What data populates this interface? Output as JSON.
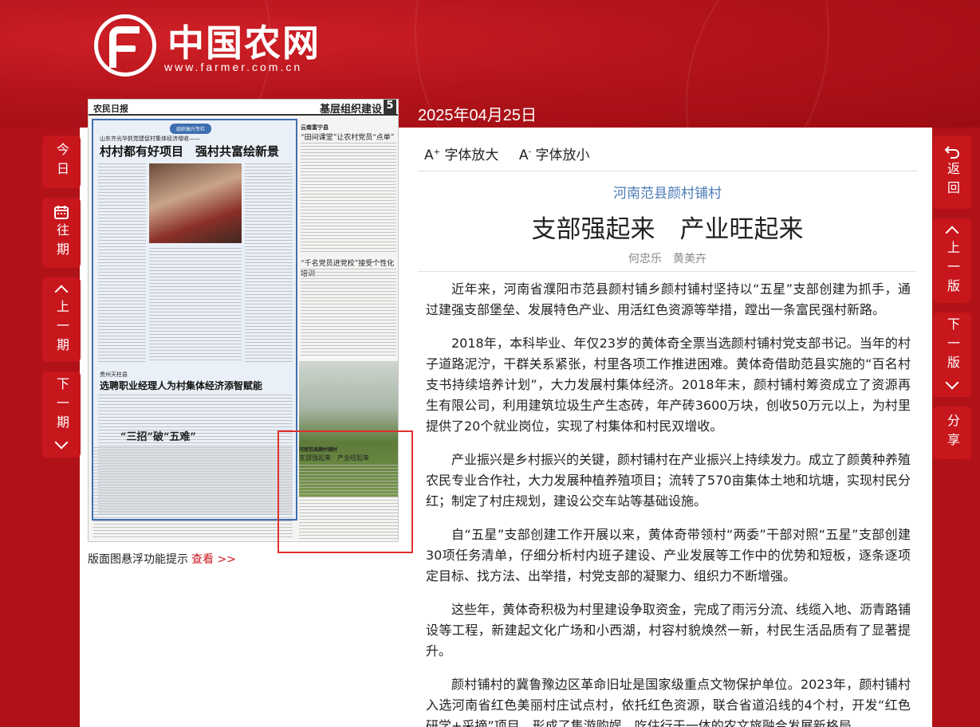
{
  "site": {
    "name": "中国农网",
    "url": "www.farmer.com.cn"
  },
  "issue_date": "2025年04月25日",
  "newspaper_thumb": {
    "brand": "农民日报",
    "section": "基层组织建设",
    "page_no": "5",
    "feature_tag": "组织振兴专栏",
    "kicker_1": "山东齐光华抓党建促村集体经济增收——",
    "headline_1": "村村都有好项目　强村共富绘新景",
    "kicker_2": "贵州天柱县",
    "headline_2": "选聘职业经理人为村集体经济添智赋能",
    "headline_3": "“三招”破“五难”",
    "right_kicker": "云南富宁县",
    "right_headline": "“田间课堂”让农村党员“点单”",
    "right_headline_2": "“千名党员进党校”接受个性化培训",
    "highlight_kicker": "河南范县颜村铺村",
    "highlight_headline": "支部强起来　产业旺起来"
  },
  "hint": {
    "text": "版面图悬浮功能提示",
    "link": "查看 >>"
  },
  "left_nav": [
    {
      "label": "今日",
      "icon": ""
    },
    {
      "label": "往期",
      "icon": "calendar-icon"
    },
    {
      "label": "上一期",
      "icon": "chevron-up-icon"
    },
    {
      "label": "下一期",
      "icon": "chevron-down-icon"
    }
  ],
  "right_nav": [
    {
      "label": "返回",
      "icon": "return-icon"
    },
    {
      "label": "上一版",
      "icon": "chevron-up-icon"
    },
    {
      "label": "下一版",
      "icon": "chevron-down-icon"
    },
    {
      "label": "分享",
      "icon": ""
    }
  ],
  "toolbar": {
    "enlarge": "字体放大",
    "shrink": "字体放小"
  },
  "article": {
    "kicker": "河南范县颜村铺村",
    "title": "支部强起来　产业旺起来",
    "authors": "何忠乐　黄美卉",
    "paragraphs": [
      "近年来，河南省濮阳市范县颜村铺乡颜村铺村坚持以“五星”支部创建为抓手，通过建强支部堡垒、发展特色产业、用活红色资源等举措，蹚出一条富民强村新路。",
      "2018年，本科毕业、年仅23岁的黄体奇全票当选颜村铺村党支部书记。当年的村子道路泥泞，干群关系紧张，村里各项工作推进困难。黄体奇借助范县实施的“百名村支书持续培养计划”，大力发展村集体经济。2018年末，颜村铺村筹资成立了资源再生有限公司，利用建筑垃圾生产生态砖，年产砖3600万块，创收50万元以上，为村里提供了20个就业岗位，实现了村集体和村民双增收。",
      "产业振兴是乡村振兴的关键，颜村铺村在产业振兴上持续发力。成立了颜黄种养殖农民专业合作社，大力发展种植养殖项目；流转了570亩集体土地和坑塘，实现村民分红；制定了村庄规划，建设公交车站等基础设施。",
      "自“五星”支部创建工作开展以来，黄体奇带领村“两委”干部对照“五星”支部创建30项任务清单，仔细分析村内班子建设、产业发展等工作中的优势和短板，逐条逐项定目标、找方法、出举措，村党支部的凝聚力、组织力不断增强。",
      "这些年，黄体奇积极为村里建设争取资金，完成了雨污分流、线缆入地、沥青路铺设等工程，新建起文化广场和小西湖，村容村貌焕然一新，村民生活品质有了显著提升。",
      "颜村铺村的冀鲁豫边区革命旧址是国家级重点文物保护单位。2023年，颜村铺村入选河南省红色美丽村庄试点村，依托红色资源，联合省道沿线的4个村，开发“红色研学+采摘”项目，形成了集游购娱、吃住行于一体的农文旅融合发展新格局。"
    ]
  },
  "colors": {
    "brand_red": "#c8161d",
    "kicker_blue": "#4c7bb5",
    "highlight_red": "#e0302b"
  }
}
